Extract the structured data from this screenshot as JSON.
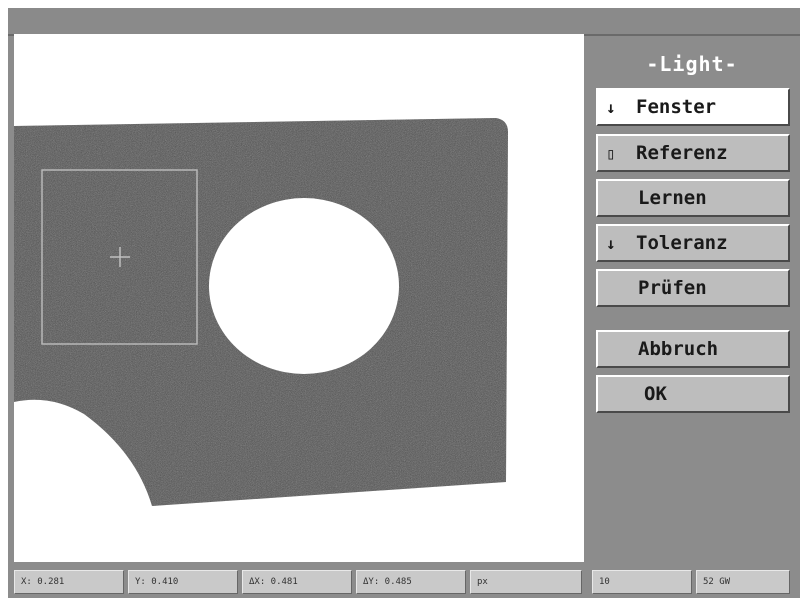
{
  "panel": {
    "title": "-Light-",
    "buttons": [
      {
        "icon": "down-arrow-icon",
        "glyph": "↓",
        "label": "Fenster"
      },
      {
        "icon": "square-icon",
        "glyph": "▯",
        "label": "Referenz"
      },
      {
        "icon": "",
        "glyph": "",
        "label": "Lernen"
      },
      {
        "icon": "down-arrow-icon",
        "glyph": "↓",
        "label": "Toleranz"
      },
      {
        "icon": "",
        "glyph": "",
        "label": "Prüfen"
      },
      {
        "icon": "",
        "glyph": "",
        "label": "Abbruch"
      },
      {
        "icon": "",
        "glyph": "",
        "label": "OK"
      }
    ]
  },
  "status": {
    "x": "X: 0.281",
    "y": "Y: 0.410",
    "dx": "ΔX: 0.481",
    "dy": "ΔY: 0.485",
    "unit": "px",
    "mode": "10",
    "gw": "52 GW"
  },
  "colors": {
    "frame": "#8c8c8c",
    "part": "#4f4f4f",
    "button": "#bdbdbd",
    "button_active": "#ffffff"
  }
}
